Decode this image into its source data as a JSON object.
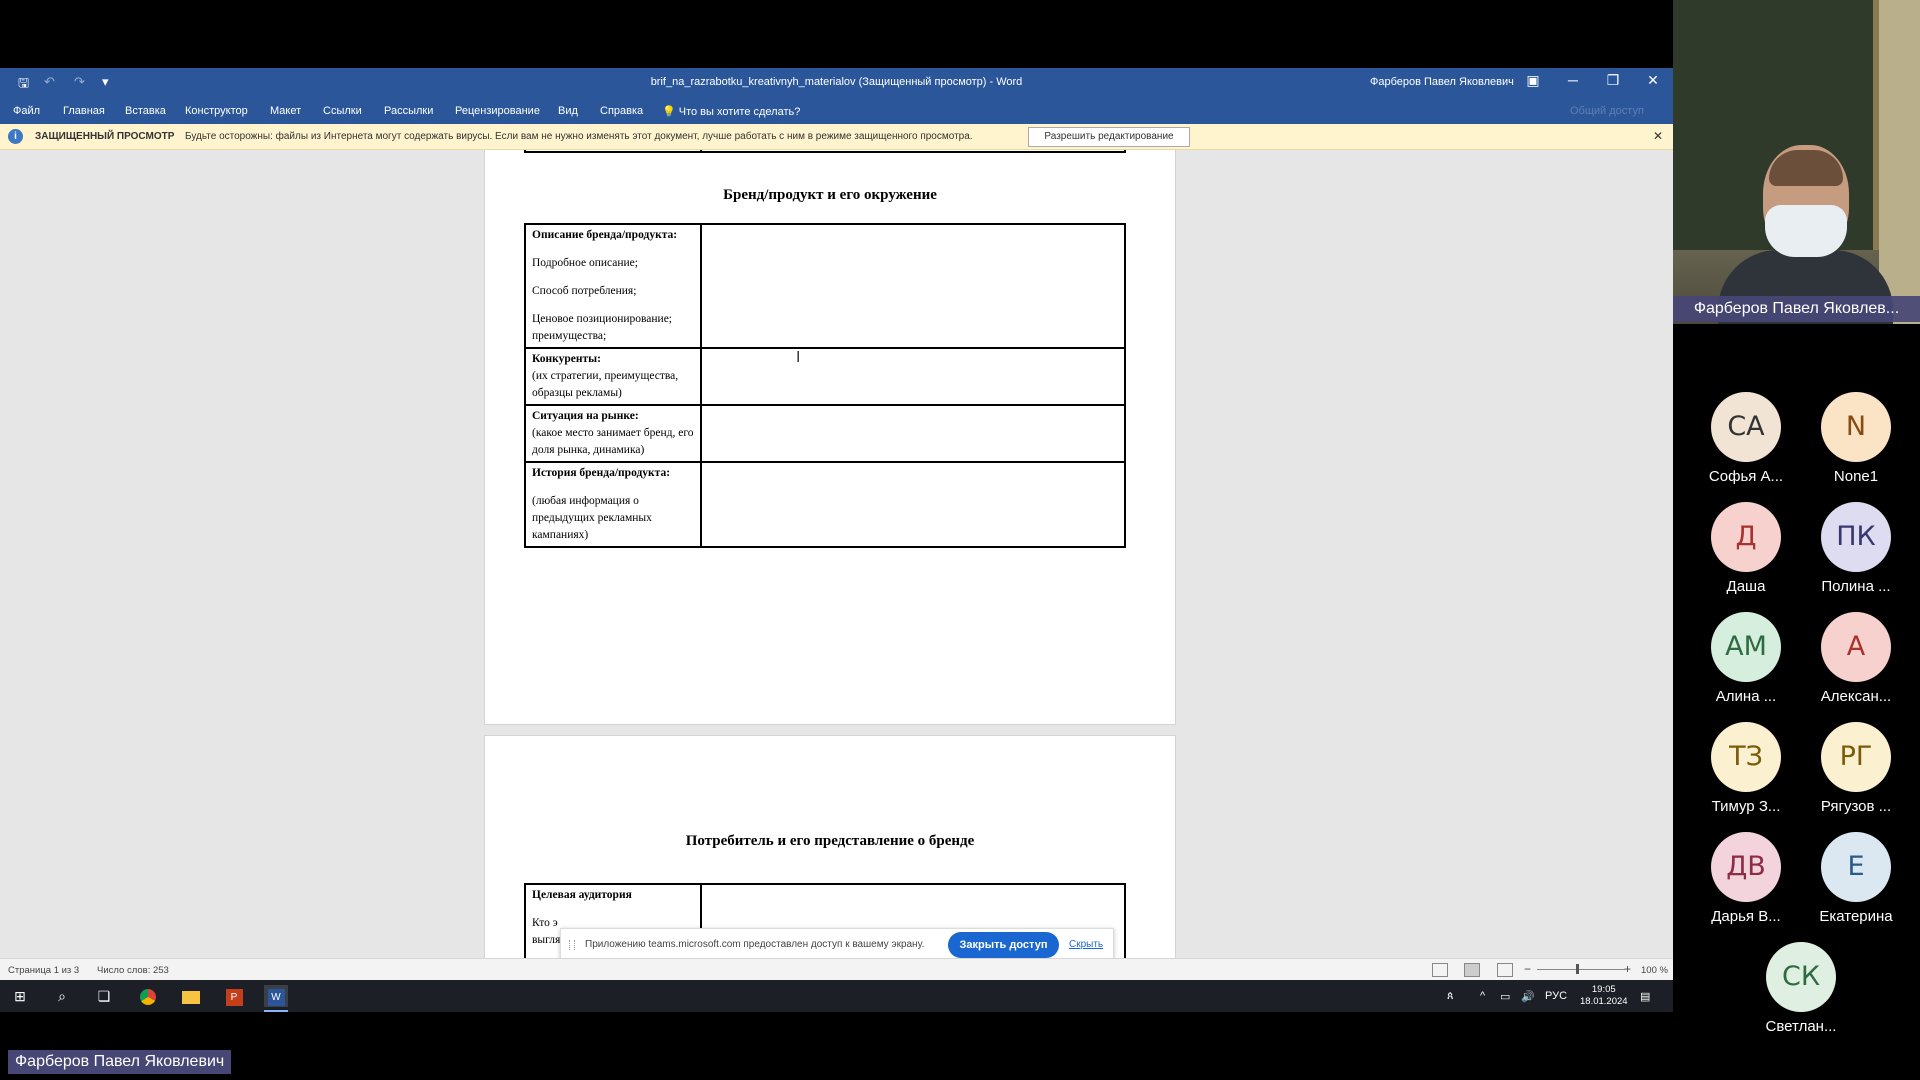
{
  "word": {
    "title": "brif_na_razrabotku_kreativnyh_materialov (Защищенный просмотр)  -  Word",
    "user": "Фарберов Павел Яковлевич",
    "ribbon_tabs": [
      "Файл",
      "Главная",
      "Вставка",
      "Конструктор",
      "Макет",
      "Ссылки",
      "Рассылки",
      "Рецензирование",
      "Вид",
      "Справка"
    ],
    "tell_me": "Что вы хотите сделать?",
    "share": "Общий доступ",
    "protected_view": {
      "label": "ЗАЩИЩЕННЫЙ ПРОСМОТР",
      "message": "Будьте осторожны: файлы из Интернета могут содержать вирусы. Если вам не нужно изменять этот документ, лучше работать с ним в режиме защищенного просмотра.",
      "enable_button": "Разрешить редактирование",
      "close": "✕"
    },
    "document": {
      "heading1": "Бренд/продукт и его окружение",
      "rows": [
        {
          "title": "Описание бренда/продукта:",
          "lines": [
            "Подробное описание;",
            "Способ потребления;",
            "Ценовое позиционирование; преимущества;"
          ]
        },
        {
          "title": "Конкуренты:",
          "desc": "(их стратегии, преимущества, образцы рекламы)"
        },
        {
          "title": "Ситуация на рынке:",
          "desc": "(какое место занимает бренд, его доля рынка, динамика)"
        },
        {
          "title": "История бренда/продукта:",
          "desc": "(любая информация о предыдущих рекламных кампаниях)"
        }
      ],
      "heading2": "Потребитель и его представление о бренде",
      "row2_title": "Целевая аудитория",
      "row2_partial_1": "Кто э",
      "row2_partial_2": "выгля"
    },
    "status": {
      "page": "Страница 1 из 3",
      "words": "Число слов: 253",
      "zoom": "100 %"
    },
    "share_notice": {
      "message": "Приложению teams.microsoft.com предоставлен доступ к вашему экрану.",
      "stop_button": "Закрыть доступ",
      "hide_link": "Скрыть"
    },
    "taskbar": {
      "lang": "РУС",
      "time": "19:05",
      "date": "18.01.2024"
    }
  },
  "teams": {
    "speaker_name": "Фарберов Павел Яковлев...",
    "participants": [
      {
        "initials": "СА",
        "name": "Софья А...",
        "bg": "#f2e4d4",
        "fg": "#333333"
      },
      {
        "initials": "N",
        "name": "None1",
        "bg": "#fbe3c6",
        "fg": "#8a4b12"
      },
      {
        "initials": "Д",
        "name": "Даша",
        "bg": "#f6d1ce",
        "fg": "#a8322d"
      },
      {
        "initials": "ПК",
        "name": "Полина ...",
        "bg": "#dedcf0",
        "fg": "#3a3770"
      },
      {
        "initials": "АМ",
        "name": "Алина ...",
        "bg": "#d6eede",
        "fg": "#2e6b42"
      },
      {
        "initials": "А",
        "name": "Алексан...",
        "bg": "#f6d1ce",
        "fg": "#a8322d"
      },
      {
        "initials": "ТЗ",
        "name": "Тимур З...",
        "bg": "#fbf0cf",
        "fg": "#7a5b08"
      },
      {
        "initials": "РГ",
        "name": "Рягузов ...",
        "bg": "#fbf0cf",
        "fg": "#7a5b08"
      },
      {
        "initials": "ДВ",
        "name": "Дарья В...",
        "bg": "#f3d4dc",
        "fg": "#8e2b45"
      },
      {
        "initials": "Е",
        "name": "Екатерина",
        "bg": "#dbe8f2",
        "fg": "#2a5a86"
      },
      {
        "initials": "СК",
        "name": "Светлан...",
        "bg": "#dff0e3",
        "fg": "#2e6b42"
      }
    ]
  },
  "presenter_label": "Фарберов Павел Яковлевич"
}
